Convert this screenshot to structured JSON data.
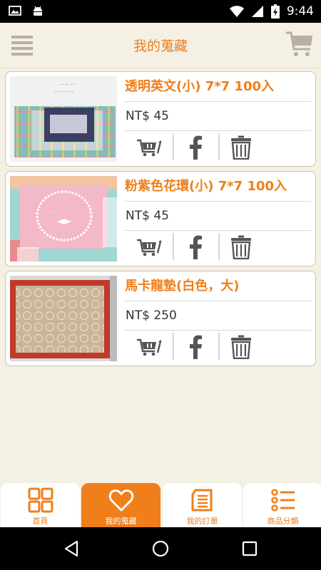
{
  "status_bar": {
    "time": "9:44"
  },
  "app_bar": {
    "title": "我的蒐藏"
  },
  "items": [
    {
      "name": "透明英文(小) 7*7 100入",
      "price": "NT$ 45"
    },
    {
      "name": "粉紫色花環(小) 7*7 100入",
      "price": "NT$ 45"
    },
    {
      "name": "馬卡龍墊(白色，大)",
      "price": "NT$ 250"
    }
  ],
  "bottom_nav": {
    "tabs": [
      {
        "label": "首頁",
        "icon": "grid-icon"
      },
      {
        "label": "我的蒐藏",
        "icon": "heart-icon",
        "active": true
      },
      {
        "label": "我的訂單",
        "icon": "document-icon"
      },
      {
        "label": "商品分類",
        "icon": "list-icon"
      }
    ]
  },
  "colors": {
    "accent": "#f07e1a",
    "background": "#f4f0e3"
  }
}
